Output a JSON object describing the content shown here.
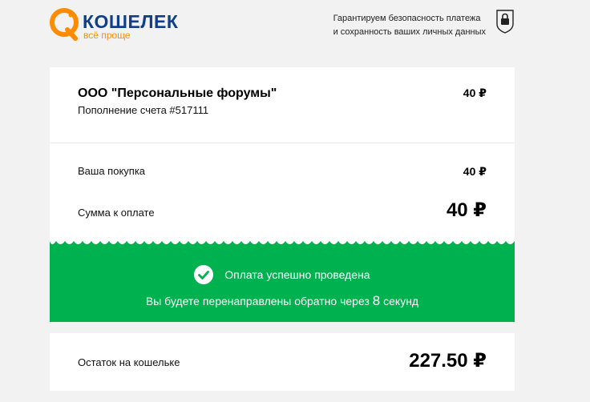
{
  "logo": {
    "name": "КОШЕЛЕК",
    "tagline": "всё проще"
  },
  "security": {
    "line1": "Гарантируем безопасность платежа",
    "line2": "и сохранность ваших личных данных"
  },
  "order": {
    "merchant": "ООО \"Персональные форумы\"",
    "invoice": "Пополнение счета #517111",
    "amount": "40 ₽"
  },
  "summary": {
    "purchase_label": "Ваша покупка",
    "purchase_amount": "40 ₽",
    "total_label": "Сумма к оплате",
    "total_amount": "40 ₽"
  },
  "status": {
    "message": "Оплата успешно проведена",
    "redirect_prefix": "Вы будете перенаправлены обратно через",
    "seconds": "8",
    "redirect_suffix": "секунд"
  },
  "balance": {
    "label": "Остаток на кошельке",
    "amount": "227.50 ₽"
  },
  "colors": {
    "success": "#00b14f",
    "brand_blue": "#0f3e8a",
    "brand_orange": "#ff8c00"
  },
  "icons": [
    "qiwi-logo-icon",
    "lock-shield-icon",
    "check-circle-icon"
  ]
}
